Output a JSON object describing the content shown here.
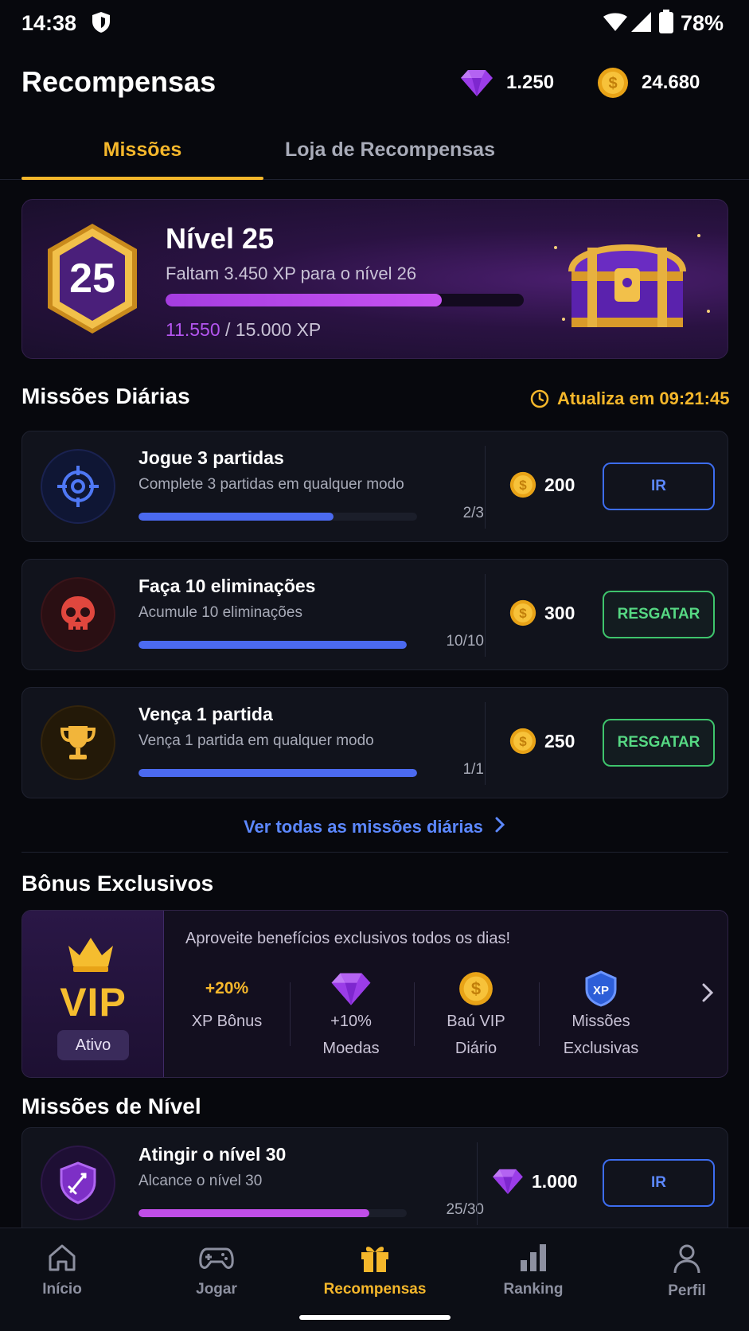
{
  "status_bar": {
    "time": "14:38",
    "battery": "78%"
  },
  "header": {
    "title": "Recompensas",
    "gems": "1.250",
    "coins": "24.680"
  },
  "tabs": [
    {
      "label": "Missões",
      "active": true
    },
    {
      "label": "Loja de Recompensas",
      "active": false
    }
  ],
  "level": {
    "badge_number": "25",
    "title": "Nível 25",
    "subtitle": "Faltam 3.450 XP para o nível 26",
    "xp_current": "11.550",
    "xp_total": "/ 15.000 XP",
    "progress": 0.77
  },
  "daily": {
    "title": "Missões Diárias",
    "refresh": "Atualiza em 09:21:45",
    "missions": [
      {
        "title": "Jogue 3 partidas",
        "desc": "Complete 3 partidas em qualquer modo",
        "count": "2/3",
        "progress": 0.7,
        "reward": "200",
        "button": "IR",
        "button_type": "go",
        "icon": "target-icon"
      },
      {
        "title": "Faça 10 eliminações",
        "desc": "Acumule 10 eliminações",
        "count": "10/10",
        "progress": 1.0,
        "reward": "300",
        "button": "RESGATAR",
        "button_type": "claim",
        "icon": "skull-icon"
      },
      {
        "title": "Vença 1 partida",
        "desc": "Vença 1 partida em qualquer modo",
        "count": "1/1",
        "progress": 1.0,
        "reward": "250",
        "button": "RESGATAR",
        "button_type": "claim",
        "icon": "trophy-icon"
      }
    ],
    "see_all": "Ver todas as missões diárias"
  },
  "bonus": {
    "title": "Bônus Exclusivos",
    "vip_label": "VIP",
    "vip_status": "Ativo",
    "description": "Aproveite benefícios exclusivos todos os dias!",
    "perks": [
      {
        "top": "+20%",
        "label1": "XP Bônus",
        "label2": ""
      },
      {
        "top": "",
        "label1": "+10%",
        "label2": "Moedas",
        "icon": "gem-icon"
      },
      {
        "top": "",
        "label1": "Baú VIP",
        "label2": "Diário",
        "icon": "coin-icon"
      },
      {
        "top": "",
        "label1": "Missões",
        "label2": "Exclusivas",
        "icon": "xp-shield-icon"
      }
    ]
  },
  "level_missions": {
    "title": "Missões de Nível",
    "mission": {
      "title": "Atingir o nível 30",
      "desc": "Alcance o nível 30",
      "count": "25/30",
      "progress": 0.86,
      "reward": "1.000",
      "button": "IR"
    }
  },
  "bottom_nav": [
    {
      "label": "Início",
      "icon": "home-icon"
    },
    {
      "label": "Jogar",
      "icon": "gamepad-icon"
    },
    {
      "label": "Recompensas",
      "icon": "gift-icon",
      "active": true
    },
    {
      "label": "Ranking",
      "icon": "ranking-icon"
    },
    {
      "label": "Perfil",
      "icon": "profile-icon"
    }
  ],
  "colors": {
    "accent": "#f5b72b",
    "blue": "#4b6af0",
    "green": "#3ec46c",
    "purple": "#b455f0"
  }
}
